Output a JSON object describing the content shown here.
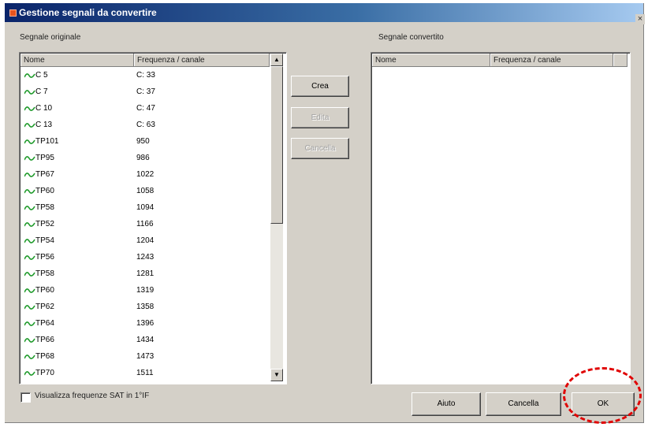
{
  "window": {
    "title": "Gestione segnali da convertire",
    "close_label": "×"
  },
  "left_panel": {
    "label": "Segnale originale",
    "columns": [
      "Nome",
      "Frequenza / canale"
    ],
    "rows": [
      {
        "name": "C 5",
        "freq": "C: 33"
      },
      {
        "name": "C 7",
        "freq": "C: 37"
      },
      {
        "name": "C 10",
        "freq": "C: 47"
      },
      {
        "name": "C 13",
        "freq": "C: 63"
      },
      {
        "name": "TP101",
        "freq": "950"
      },
      {
        "name": "TP95",
        "freq": "986"
      },
      {
        "name": "TP67",
        "freq": "1022"
      },
      {
        "name": "TP60",
        "freq": "1058"
      },
      {
        "name": "TP58",
        "freq": "1094"
      },
      {
        "name": "TP52",
        "freq": "1166"
      },
      {
        "name": "TP54",
        "freq": "1204"
      },
      {
        "name": "TP56",
        "freq": "1243"
      },
      {
        "name": "TP58",
        "freq": "1281"
      },
      {
        "name": "TP60",
        "freq": "1319"
      },
      {
        "name": "TP62",
        "freq": "1358"
      },
      {
        "name": "TP64",
        "freq": "1396"
      },
      {
        "name": "TP66",
        "freq": "1434"
      },
      {
        "name": "TP68",
        "freq": "1473"
      },
      {
        "name": "TP70",
        "freq": "1511"
      }
    ],
    "scroll_up": "▲",
    "scroll_down": "▼"
  },
  "middle_buttons": {
    "crea": "Crea",
    "edita": "Edita",
    "cancella": "Cancella"
  },
  "right_panel": {
    "label": "Segnale convertito",
    "columns": [
      "Nome",
      "Frequenza / canale"
    ]
  },
  "options": {
    "checkbox_label": "Visualizza frequenze SAT in 1°IF",
    "checkbox_checked": false
  },
  "footer": {
    "aiuto": "Aiuto",
    "cancella": "Cancella",
    "ok": "OK"
  },
  "colors": {
    "signal_icon": "#1e9a2a",
    "title_bar": "#0a246a",
    "annotation": "#e00000"
  },
  "icons": {
    "row_icon": "signal-wave-icon"
  }
}
